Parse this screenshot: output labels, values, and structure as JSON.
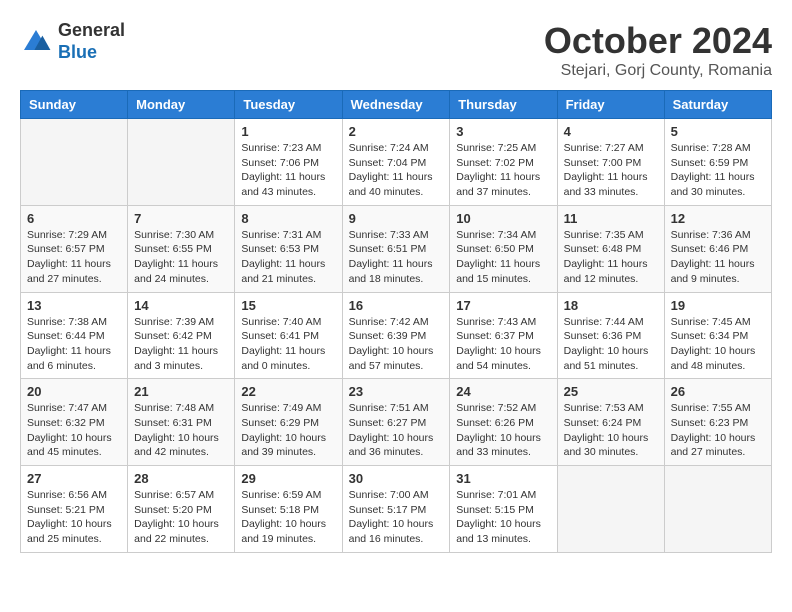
{
  "header": {
    "logo_line1": "General",
    "logo_line2": "Blue",
    "month_title": "October 2024",
    "subtitle": "Stejari, Gorj County, Romania"
  },
  "days_of_week": [
    "Sunday",
    "Monday",
    "Tuesday",
    "Wednesday",
    "Thursday",
    "Friday",
    "Saturday"
  ],
  "weeks": [
    [
      {
        "day": "",
        "info": ""
      },
      {
        "day": "",
        "info": ""
      },
      {
        "day": "1",
        "sunrise": "7:23 AM",
        "sunset": "7:06 PM",
        "daylight": "11 hours and 43 minutes."
      },
      {
        "day": "2",
        "sunrise": "7:24 AM",
        "sunset": "7:04 PM",
        "daylight": "11 hours and 40 minutes."
      },
      {
        "day": "3",
        "sunrise": "7:25 AM",
        "sunset": "7:02 PM",
        "daylight": "11 hours and 37 minutes."
      },
      {
        "day": "4",
        "sunrise": "7:27 AM",
        "sunset": "7:00 PM",
        "daylight": "11 hours and 33 minutes."
      },
      {
        "day": "5",
        "sunrise": "7:28 AM",
        "sunset": "6:59 PM",
        "daylight": "11 hours and 30 minutes."
      }
    ],
    [
      {
        "day": "6",
        "sunrise": "7:29 AM",
        "sunset": "6:57 PM",
        "daylight": "11 hours and 27 minutes."
      },
      {
        "day": "7",
        "sunrise": "7:30 AM",
        "sunset": "6:55 PM",
        "daylight": "11 hours and 24 minutes."
      },
      {
        "day": "8",
        "sunrise": "7:31 AM",
        "sunset": "6:53 PM",
        "daylight": "11 hours and 21 minutes."
      },
      {
        "day": "9",
        "sunrise": "7:33 AM",
        "sunset": "6:51 PM",
        "daylight": "11 hours and 18 minutes."
      },
      {
        "day": "10",
        "sunrise": "7:34 AM",
        "sunset": "6:50 PM",
        "daylight": "11 hours and 15 minutes."
      },
      {
        "day": "11",
        "sunrise": "7:35 AM",
        "sunset": "6:48 PM",
        "daylight": "11 hours and 12 minutes."
      },
      {
        "day": "12",
        "sunrise": "7:36 AM",
        "sunset": "6:46 PM",
        "daylight": "11 hours and 9 minutes."
      }
    ],
    [
      {
        "day": "13",
        "sunrise": "7:38 AM",
        "sunset": "6:44 PM",
        "daylight": "11 hours and 6 minutes."
      },
      {
        "day": "14",
        "sunrise": "7:39 AM",
        "sunset": "6:42 PM",
        "daylight": "11 hours and 3 minutes."
      },
      {
        "day": "15",
        "sunrise": "7:40 AM",
        "sunset": "6:41 PM",
        "daylight": "11 hours and 0 minutes."
      },
      {
        "day": "16",
        "sunrise": "7:42 AM",
        "sunset": "6:39 PM",
        "daylight": "10 hours and 57 minutes."
      },
      {
        "day": "17",
        "sunrise": "7:43 AM",
        "sunset": "6:37 PM",
        "daylight": "10 hours and 54 minutes."
      },
      {
        "day": "18",
        "sunrise": "7:44 AM",
        "sunset": "6:36 PM",
        "daylight": "10 hours and 51 minutes."
      },
      {
        "day": "19",
        "sunrise": "7:45 AM",
        "sunset": "6:34 PM",
        "daylight": "10 hours and 48 minutes."
      }
    ],
    [
      {
        "day": "20",
        "sunrise": "7:47 AM",
        "sunset": "6:32 PM",
        "daylight": "10 hours and 45 minutes."
      },
      {
        "day": "21",
        "sunrise": "7:48 AM",
        "sunset": "6:31 PM",
        "daylight": "10 hours and 42 minutes."
      },
      {
        "day": "22",
        "sunrise": "7:49 AM",
        "sunset": "6:29 PM",
        "daylight": "10 hours and 39 minutes."
      },
      {
        "day": "23",
        "sunrise": "7:51 AM",
        "sunset": "6:27 PM",
        "daylight": "10 hours and 36 minutes."
      },
      {
        "day": "24",
        "sunrise": "7:52 AM",
        "sunset": "6:26 PM",
        "daylight": "10 hours and 33 minutes."
      },
      {
        "day": "25",
        "sunrise": "7:53 AM",
        "sunset": "6:24 PM",
        "daylight": "10 hours and 30 minutes."
      },
      {
        "day": "26",
        "sunrise": "7:55 AM",
        "sunset": "6:23 PM",
        "daylight": "10 hours and 27 minutes."
      }
    ],
    [
      {
        "day": "27",
        "sunrise": "6:56 AM",
        "sunset": "5:21 PM",
        "daylight": "10 hours and 25 minutes."
      },
      {
        "day": "28",
        "sunrise": "6:57 AM",
        "sunset": "5:20 PM",
        "daylight": "10 hours and 22 minutes."
      },
      {
        "day": "29",
        "sunrise": "6:59 AM",
        "sunset": "5:18 PM",
        "daylight": "10 hours and 19 minutes."
      },
      {
        "day": "30",
        "sunrise": "7:00 AM",
        "sunset": "5:17 PM",
        "daylight": "10 hours and 16 minutes."
      },
      {
        "day": "31",
        "sunrise": "7:01 AM",
        "sunset": "5:15 PM",
        "daylight": "10 hours and 13 minutes."
      },
      {
        "day": "",
        "info": ""
      },
      {
        "day": "",
        "info": ""
      }
    ]
  ],
  "labels": {
    "sunrise_prefix": "Sunrise: ",
    "sunset_prefix": "Sunset: ",
    "daylight_prefix": "Daylight: "
  }
}
